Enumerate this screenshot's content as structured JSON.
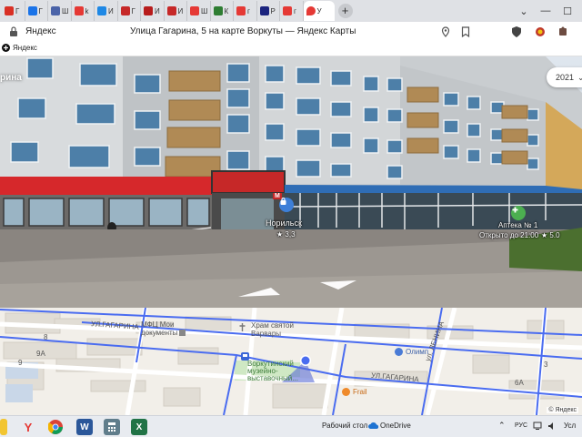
{
  "browser": {
    "tabs": [
      {
        "label": "Г",
        "color": "#d93025"
      },
      {
        "label": "Г",
        "color": "#1a73e8"
      },
      {
        "label": "Ш",
        "color": "#4a63a8"
      },
      {
        "label": "k",
        "color": "#e53935"
      },
      {
        "label": "И",
        "color": "#1e88e5"
      },
      {
        "label": "Г",
        "color": "#c62828"
      },
      {
        "label": "И",
        "color": "#b71c1c"
      },
      {
        "label": "И",
        "color": "#c62828"
      },
      {
        "label": "Ш",
        "color": "#e53935"
      },
      {
        "label": "К",
        "color": "#2e7d32"
      },
      {
        "label": "г",
        "color": "#e53935"
      },
      {
        "label": "Р",
        "color": "#1a237e"
      },
      {
        "label": "г",
        "color": "#e53935"
      }
    ],
    "active_tab": {
      "label": "У",
      "color": "#e53935"
    },
    "new_tab_label": "+",
    "window_controls": {
      "chevron": "⌄",
      "minimize": "—",
      "maximize": "☐"
    }
  },
  "addressbar": {
    "site_name": "Яндекс",
    "page_title": "Улица Гагарина, 5 на карте Воркуты — Яндекс Карты"
  },
  "bookmarks": {
    "label": "Яндекс"
  },
  "panorama": {
    "street_fragment": "рина",
    "year": "2021",
    "year_chevron": "⌄",
    "poi_store": {
      "name": "Норильск",
      "rating": "★ 3,3"
    },
    "poi_pharmacy": {
      "name": "Аптека № 1",
      "hours": "Открыто до 21:00",
      "rating": "★ 5.0"
    },
    "shop_sign": "М"
  },
  "map": {
    "labels": {
      "street_1": "УЛ.ГАГАРИНА",
      "street_2": "УЛ.ГАГАРИНА",
      "street_3": "ул. ЛЕНИНА",
      "mfc": "МФЦ Мои\nдокументы",
      "church": "Храм святой\nВарвары",
      "museum": "Воркутинский\nмузейно-\nвыставочный...",
      "olimp": "Олимп",
      "frail": "Frail",
      "num_8": "8",
      "num_9a": "9А",
      "num_9": "9",
      "num_6a": "6А",
      "num_3": "3"
    },
    "copyright": "© Яндекс"
  },
  "taskbar": {
    "desktop_label": "Рабочий стол",
    "onedrive_label": "OneDrive",
    "tray_chevron": "⌃",
    "tray_lang": "РУС",
    "tray_suffix": "Усл"
  }
}
